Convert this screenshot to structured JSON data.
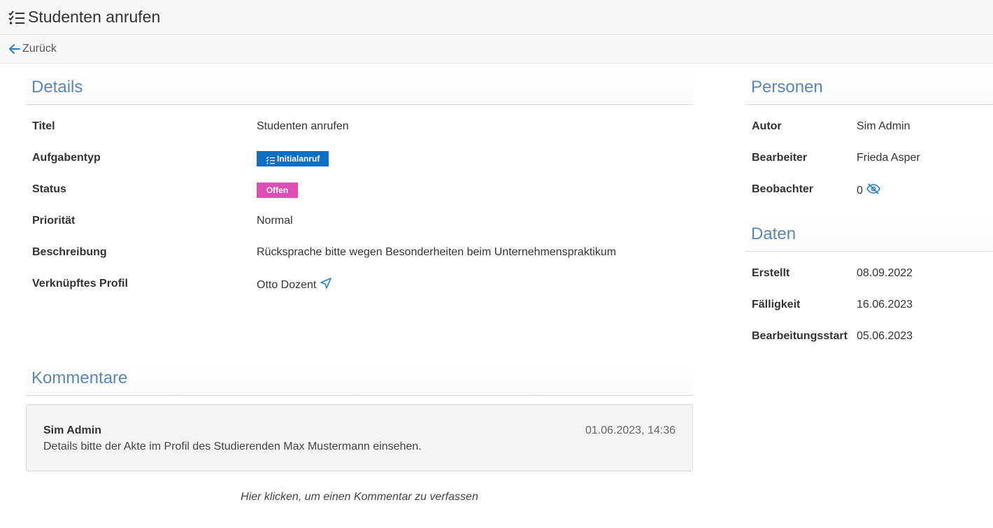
{
  "header": {
    "title": "Studenten anrufen",
    "icon": "task-list-icon"
  },
  "nav": {
    "back_label": "Zurück",
    "back_icon": "arrow-left-icon"
  },
  "details": {
    "heading": "Details",
    "fields": {
      "titel": {
        "label": "Titel",
        "value": "Studenten anrufen"
      },
      "aufgabentyp": {
        "label": "Aufgabentyp",
        "value": "Initialanruf",
        "color": "#0d6fc4"
      },
      "status": {
        "label": "Status",
        "value": "Offen",
        "color": "#df4db3"
      },
      "prioritaet": {
        "label": "Priorität",
        "value": "Normal"
      },
      "beschreibung": {
        "label": "Beschreibung",
        "value": "Rücksprache bitte wegen Besonderheiten beim Unternehmenspraktikum"
      },
      "profil": {
        "label": "Verknüpftes Profil",
        "value": "Otto Dozent",
        "icon": "paper-plane-icon"
      }
    }
  },
  "personen": {
    "heading": "Personen",
    "autor": {
      "label": "Autor",
      "value": "Sim Admin"
    },
    "bearbeiter": {
      "label": "Bearbeiter",
      "value": "Frieda Asper"
    },
    "beobachter": {
      "label": "Beobachter",
      "value": "0",
      "icon": "eye-slash-icon"
    }
  },
  "daten": {
    "heading": "Daten",
    "erstellt": {
      "label": "Erstellt",
      "value": "08.09.2022"
    },
    "faelligkeit": {
      "label": "Fälligkeit",
      "value": "16.06.2023"
    },
    "bearbeitungsstart": {
      "label": "Bearbeitungsstart",
      "value": "05.06.2023"
    }
  },
  "kommentare": {
    "heading": "Kommentare",
    "items": [
      {
        "author": "Sim Admin",
        "timestamp": "01.06.2023, 14:36",
        "text": "Details bitte der Akte im Profil des Studierenden Max Mustermann einsehen."
      }
    ],
    "add_label": "Hier klicken, um einen Kommentar zu verfassen"
  },
  "colors": {
    "accent": "#5b87b5",
    "link_icon": "#2a7fc1"
  }
}
